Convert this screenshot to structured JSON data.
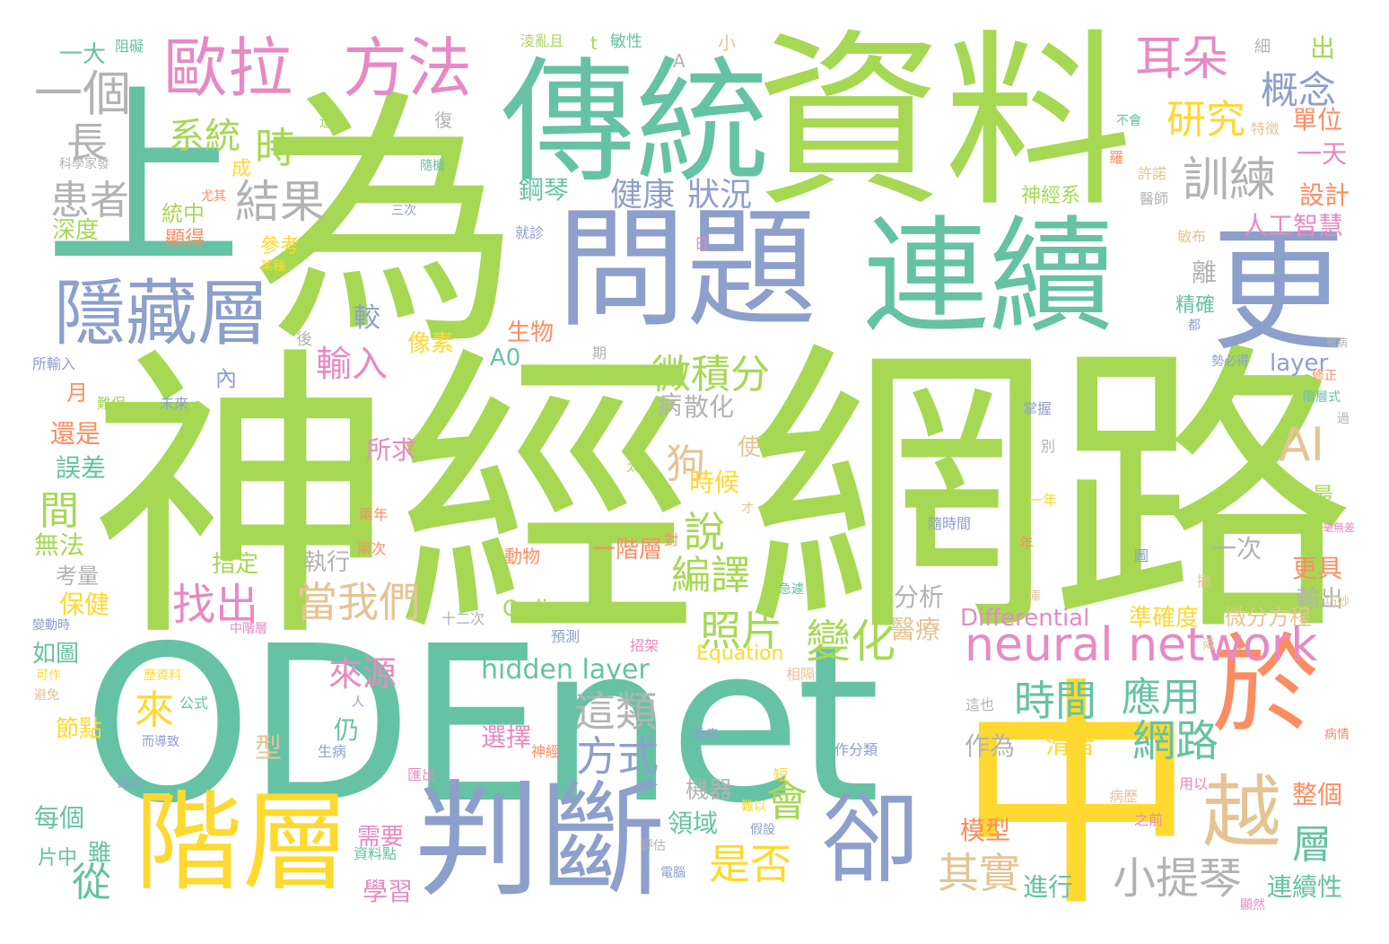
{
  "words": [
    {
      "text": "ODEnet",
      "color": "#66c2a5"
    },
    {
      "text": "神經",
      "color": "#a6d854"
    },
    {
      "text": "網路",
      "color": "#a6d854"
    },
    {
      "text": "為",
      "color": "#a6d854"
    },
    {
      "text": "上",
      "color": "#66c2a5"
    },
    {
      "text": "資料",
      "color": "#a6d854"
    },
    {
      "text": "中",
      "color": "#ffd92f"
    },
    {
      "text": "傳統",
      "color": "#66c2a5"
    },
    {
      "text": "問題",
      "color": "#8da0cb"
    },
    {
      "text": "連續",
      "color": "#66c2a5"
    },
    {
      "text": "更",
      "color": "#8da0cb"
    },
    {
      "text": "判斷",
      "color": "#8da0cb"
    },
    {
      "text": "階層",
      "color": "#ffd92f"
    },
    {
      "text": "於",
      "color": "#fc8d62"
    },
    {
      "text": "卻",
      "color": "#8da0cb"
    },
    {
      "text": "越",
      "color": "#e5c494"
    },
    {
      "text": "隱藏層",
      "color": "#8da0cb"
    },
    {
      "text": "歐拉",
      "color": "#e78ac3"
    },
    {
      "text": "方法",
      "color": "#e78ac3"
    },
    {
      "text": "neural network",
      "color": "#e78ac3"
    },
    {
      "text": "一個",
      "color": "#b3b3b3"
    },
    {
      "text": "耳朵",
      "color": "#e78ac3"
    },
    {
      "text": "研究",
      "color": "#ffd92f"
    },
    {
      "text": "概念",
      "color": "#8da0cb"
    },
    {
      "text": "訓練",
      "color": "#b3b3b3"
    },
    {
      "text": "系統",
      "color": "#a6d854"
    },
    {
      "text": "時",
      "color": "#a6d854"
    },
    {
      "text": "長",
      "color": "#b3b3b3"
    },
    {
      "text": "結果",
      "color": "#b3b3b3"
    },
    {
      "text": "患者",
      "color": "#b3b3b3"
    },
    {
      "text": "健康",
      "color": "#8da0cb"
    },
    {
      "text": "狀況",
      "color": "#8da0cb"
    },
    {
      "text": "微積分",
      "color": "#a6d854"
    },
    {
      "text": "輸入",
      "color": "#e78ac3"
    },
    {
      "text": "AI",
      "color": "#e5c494"
    },
    {
      "text": "狗",
      "color": "#e5c494"
    },
    {
      "text": "照片",
      "color": "#a6d854"
    },
    {
      "text": "變化",
      "color": "#a6d854"
    },
    {
      "text": "說",
      "color": "#a6d854"
    },
    {
      "text": "編譯",
      "color": "#a6d854"
    },
    {
      "text": "找出",
      "color": "#e78ac3"
    },
    {
      "text": "當我們",
      "color": "#e5c494"
    },
    {
      "text": "時間",
      "color": "#66c2a5"
    },
    {
      "text": "應用",
      "color": "#66c2a5"
    },
    {
      "text": "網路",
      "color": "#66c2a5"
    },
    {
      "text": "這類",
      "color": "#b3b3b3"
    },
    {
      "text": "方式",
      "color": "#8da0cb"
    },
    {
      "text": "來源",
      "color": "#e78ac3"
    },
    {
      "text": "來",
      "color": "#ffd92f"
    },
    {
      "text": "是否",
      "color": "#ffd92f"
    },
    {
      "text": "會",
      "color": "#a6d854"
    },
    {
      "text": "其實",
      "color": "#e5c494"
    },
    {
      "text": "小提琴",
      "color": "#b3b3b3"
    },
    {
      "text": "層",
      "color": "#66c2a5"
    },
    {
      "text": "間",
      "color": "#a6d854"
    },
    {
      "text": "從",
      "color": "#66c2a5"
    },
    {
      "text": "hidden layer",
      "color": "#66c2a5"
    },
    {
      "text": "人工智慧",
      "color": "#e78ac3"
    },
    {
      "text": "設計",
      "color": "#fc8d62"
    },
    {
      "text": "單位",
      "color": "#fc8d62"
    },
    {
      "text": "一天",
      "color": "#e78ac3"
    },
    {
      "text": "出",
      "color": "#a6d854"
    },
    {
      "text": "一大",
      "color": "#66c2a5"
    },
    {
      "text": "深度",
      "color": "#a6d854"
    },
    {
      "text": "統中",
      "color": "#a6d854"
    },
    {
      "text": "還是",
      "color": "#fc8d62"
    },
    {
      "text": "誤差",
      "color": "#66c2a5"
    },
    {
      "text": "無法",
      "color": "#a6d854"
    },
    {
      "text": "保健",
      "color": "#ffd92f"
    },
    {
      "text": "如圖",
      "color": "#66c2a5"
    },
    {
      "text": "節點",
      "color": "#ffd92f"
    },
    {
      "text": "每個",
      "color": "#66c2a5"
    },
    {
      "text": "雖",
      "color": "#66c2a5"
    },
    {
      "text": "生物",
      "color": "#fc8d62"
    },
    {
      "text": "像素",
      "color": "#ffd92f"
    },
    {
      "text": "A0",
      "color": "#66c2a5"
    },
    {
      "text": "散化",
      "color": "#b3b3b3"
    },
    {
      "text": "病",
      "color": "#b3b3b3"
    },
    {
      "text": "所求",
      "color": "#e78ac3"
    },
    {
      "text": "時候",
      "color": "#ffd92f"
    },
    {
      "text": "一階層",
      "color": "#fc8d62"
    },
    {
      "text": "一次",
      "color": "#b3b3b3"
    },
    {
      "text": "更具",
      "color": "#fc8d62"
    },
    {
      "text": "輸出",
      "color": "#b3b3b3"
    },
    {
      "text": "分析",
      "color": "#b3b3b3"
    },
    {
      "text": "醫療",
      "color": "#e5c494"
    },
    {
      "text": "Ordinary",
      "color": "#a6d854"
    },
    {
      "text": "Differential",
      "color": "#e78ac3"
    },
    {
      "text": "Equation",
      "color": "#ffd92f"
    },
    {
      "text": "準確度",
      "color": "#ffd92f"
    },
    {
      "text": "微分方程",
      "color": "#e5c494"
    },
    {
      "text": "layer",
      "color": "#8da0cb"
    },
    {
      "text": "作為",
      "color": "#b3b3b3"
    },
    {
      "text": "滑音",
      "color": "#ffd92f"
    },
    {
      "text": "機器",
      "color": "#b3b3b3"
    },
    {
      "text": "領域",
      "color": "#66c2a5"
    },
    {
      "text": "選擇",
      "color": "#e78ac3"
    },
    {
      "text": "模型",
      "color": "#fc8d62"
    },
    {
      "text": "進行",
      "color": "#66c2a5"
    },
    {
      "text": "連續性",
      "color": "#66c2a5"
    },
    {
      "text": "整個",
      "color": "#fc8d62"
    },
    {
      "text": "需要",
      "color": "#e78ac3"
    },
    {
      "text": "學習",
      "color": "#e78ac3"
    },
    {
      "text": "型",
      "color": "#e5c494"
    },
    {
      "text": "仍",
      "color": "#66c2a5"
    },
    {
      "text": "指定",
      "color": "#a6d854"
    },
    {
      "text": "執行",
      "color": "#b3b3b3"
    },
    {
      "text": "考量",
      "color": "#b3b3b3"
    },
    {
      "text": "月",
      "color": "#fc8d62"
    },
    {
      "text": "片中",
      "color": "#66c2a5"
    },
    {
      "text": "較",
      "color": "#8da0cb"
    },
    {
      "text": "離",
      "color": "#b3b3b3"
    },
    {
      "text": "精確",
      "color": "#66c2a5"
    },
    {
      "text": "神經系",
      "color": "#a6d854"
    },
    {
      "text": "鋼琴",
      "color": "#66c2a5"
    },
    {
      "text": "成",
      "color": "#ffd92f"
    },
    {
      "text": "參考",
      "color": "#ffd92f"
    },
    {
      "text": "顯得",
      "color": "#fc8d62"
    },
    {
      "text": "使",
      "color": "#e5c494"
    },
    {
      "text": "內",
      "color": "#8da0cb"
    },
    {
      "text": "最",
      "color": "#a6d854"
    },
    {
      "text": "t",
      "color": "#a6d854"
    },
    {
      "text": "A",
      "color": "#b3b3b3"
    },
    {
      "text": "小",
      "color": "#e5c494"
    },
    {
      "text": "細",
      "color": "#b3b3b3"
    },
    {
      "text": "復",
      "color": "#b3b3b3"
    },
    {
      "text": "敏性",
      "color": "#66c2a5"
    },
    {
      "text": "淩亂且",
      "color": "#a6d854"
    },
    {
      "text": "阻礙",
      "color": "#66c2a5"
    },
    {
      "text": "不會",
      "color": "#66c2a5"
    },
    {
      "text": "特徵",
      "color": "#e5c494"
    },
    {
      "text": "許諾",
      "color": "#e5c494"
    },
    {
      "text": "醫師",
      "color": "#b3b3b3"
    },
    {
      "text": "敏布",
      "color": "#e5c494"
    },
    {
      "text": "日",
      "color": "#e78ac3"
    },
    {
      "text": "就診",
      "color": "#8da0cb"
    },
    {
      "text": "三次",
      "color": "#8da0cb"
    },
    {
      "text": "尤其",
      "color": "#fc8d62"
    },
    {
      "text": "隨機",
      "color": "#66c2a5"
    },
    {
      "text": "科學家發",
      "color": "#b3b3b3"
    },
    {
      "text": "還",
      "color": "#a6d854"
    },
    {
      "text": "羅",
      "color": "#fc8d62"
    },
    {
      "text": "期",
      "color": "#b3b3b3"
    },
    {
      "text": "後",
      "color": "#b3b3b3"
    },
    {
      "text": "所輸入",
      "color": "#8da0cb"
    },
    {
      "text": "難保",
      "color": "#a6d854"
    },
    {
      "text": "未來",
      "color": "#8da0cb"
    },
    {
      "text": "太過",
      "color": "#a6d854"
    },
    {
      "text": "兩年",
      "color": "#fc8d62"
    },
    {
      "text": "兩次",
      "color": "#fc8d62"
    },
    {
      "text": "對",
      "color": "#fc8d62"
    },
    {
      "text": "動物",
      "color": "#fc8d62"
    },
    {
      "text": "十二次",
      "color": "#b3b3b3"
    },
    {
      "text": "預測",
      "color": "#8da0cb"
    },
    {
      "text": "招架",
      "color": "#e78ac3"
    },
    {
      "text": "相隔",
      "color": "#e5c494"
    },
    {
      "text": "掌握",
      "color": "#8da0cb"
    },
    {
      "text": "別",
      "color": "#b3b3b3"
    },
    {
      "text": "一年",
      "color": "#ffd92f"
    },
    {
      "text": "年",
      "color": "#fc8d62"
    },
    {
      "text": "隨時間",
      "color": "#8da0cb"
    },
    {
      "text": "圖",
      "color": "#8da0cb"
    },
    {
      "text": "撤",
      "color": "#e5c494"
    },
    {
      "text": "巧妙",
      "color": "#e5c494"
    },
    {
      "text": "修正",
      "color": "#fc8d62"
    },
    {
      "text": "階層式",
      "color": "#66c2a5"
    },
    {
      "text": "勢必得",
      "color": "#8da0cb"
    },
    {
      "text": "都",
      "color": "#8da0cb"
    },
    {
      "text": "病歷",
      "color": "#e5c494"
    },
    {
      "text": "之前",
      "color": "#e78ac3"
    },
    {
      "text": "用以",
      "color": "#e78ac3"
    },
    {
      "text": "這也",
      "color": "#b3b3b3"
    },
    {
      "text": "看病",
      "color": "#8da0cb"
    },
    {
      "text": "作分類",
      "color": "#8da0cb"
    },
    {
      "text": "短",
      "color": "#ffd92f"
    },
    {
      "text": "難以",
      "color": "#ffd92f"
    },
    {
      "text": "假設",
      "color": "#8da0cb"
    },
    {
      "text": "評估",
      "color": "#b3b3b3"
    },
    {
      "text": "電腦",
      "color": "#8da0cb"
    },
    {
      "text": "資料點",
      "color": "#66c2a5"
    },
    {
      "text": "神經",
      "color": "#fc8d62"
    },
    {
      "text": "匯出",
      "color": "#e78ac3"
    },
    {
      "text": "生病",
      "color": "#8da0cb"
    },
    {
      "text": "人",
      "color": "#8da0cb"
    },
    {
      "text": "公式",
      "color": "#66c2a5"
    },
    {
      "text": "而導致",
      "color": "#8da0cb"
    },
    {
      "text": "避免",
      "color": "#e5c494"
    },
    {
      "text": "可作",
      "color": "#ffd92f"
    },
    {
      "text": "歷資料",
      "color": "#ffd92f"
    },
    {
      "text": "中階層",
      "color": "#e78ac3"
    },
    {
      "text": "變動時",
      "color": "#8da0cb"
    },
    {
      "text": "健康",
      "color": "#8da0cb"
    },
    {
      "text": "病情",
      "color": "#fc8d62"
    },
    {
      "text": "兩",
      "color": "#e5c494"
    },
    {
      "text": "顯然",
      "color": "#e78ac3"
    },
    {
      "text": "才",
      "color": "#e5c494"
    },
    {
      "text": "急遽",
      "color": "#66c2a5"
    },
    {
      "text": "庫",
      "color": "#e5c494"
    },
    {
      "text": "某種",
      "color": "#ffd92f"
    },
    {
      "text": "罹病",
      "color": "#b3b3b3"
    },
    {
      "text": "過",
      "color": "#b3b3b3"
    },
    {
      "text": "毫無差",
      "color": "#e78ac3"
    }
  ]
}
